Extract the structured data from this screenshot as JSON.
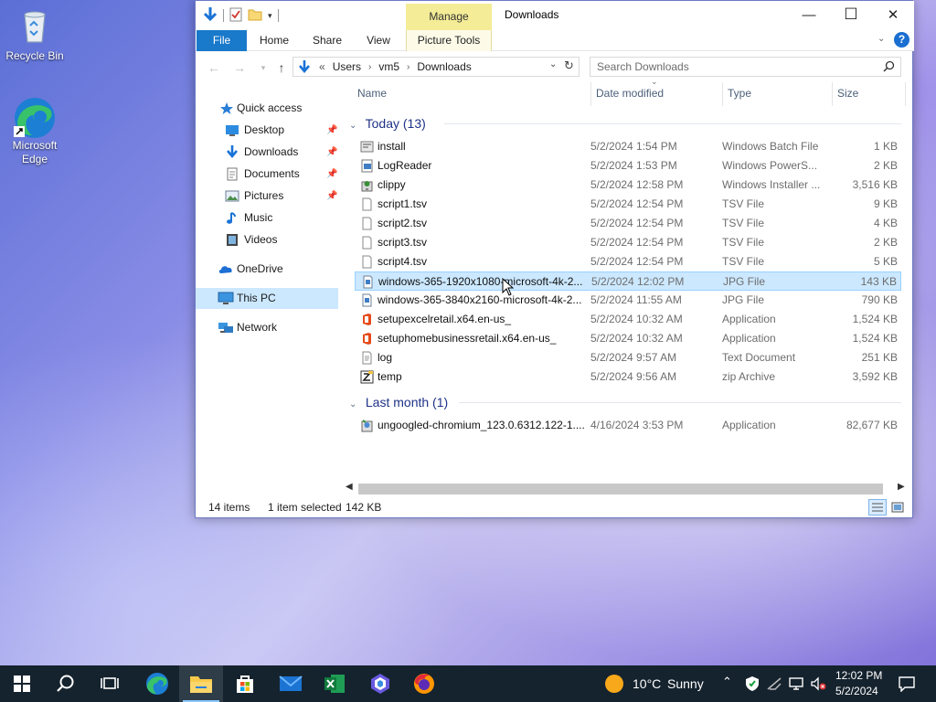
{
  "desktop": {
    "icons": [
      {
        "label": "Recycle Bin"
      },
      {
        "label": "Microsoft Edge"
      }
    ]
  },
  "window": {
    "title": "Downloads",
    "manage_tab": "Manage",
    "ribbon_tabs": [
      "File",
      "Home",
      "Share",
      "View",
      "Picture Tools"
    ],
    "controls": {
      "minimize": "—",
      "maximize": "☐",
      "close": "✕"
    },
    "help": "?"
  },
  "address": {
    "prefix": "«",
    "crumbs": [
      "Users",
      "vm5",
      "Downloads"
    ]
  },
  "search": {
    "placeholder": "Search Downloads"
  },
  "nav_pane": {
    "items": [
      {
        "label": "Quick access",
        "icon": "star-icon",
        "pinned": false
      },
      {
        "label": "Desktop",
        "icon": "desktop-folder-icon",
        "pinned": true
      },
      {
        "label": "Downloads",
        "icon": "download-arrow-icon",
        "pinned": true
      },
      {
        "label": "Documents",
        "icon": "documents-icon",
        "pinned": true
      },
      {
        "label": "Pictures",
        "icon": "pictures-icon",
        "pinned": true
      },
      {
        "label": "Music",
        "icon": "music-note-icon",
        "pinned": false
      },
      {
        "label": "Videos",
        "icon": "videos-icon",
        "pinned": false
      },
      {
        "label": "OneDrive",
        "icon": "cloud-icon",
        "pinned": false
      },
      {
        "label": "This PC",
        "icon": "computer-icon",
        "pinned": false,
        "selected": true
      },
      {
        "label": "Network",
        "icon": "network-icon",
        "pinned": false
      }
    ]
  },
  "columns": {
    "name": "Name",
    "date": "Date modified",
    "type": "Type",
    "size": "Size"
  },
  "groups": [
    {
      "header": "Today (13)",
      "files": [
        {
          "name": "install",
          "date": "5/2/2024 1:54 PM",
          "type": "Windows Batch File",
          "size": "1 KB",
          "icon": "batch-file-icon"
        },
        {
          "name": "LogReader",
          "date": "5/2/2024 1:53 PM",
          "type": "Windows PowerS...",
          "size": "2 KB",
          "icon": "powershell-file-icon"
        },
        {
          "name": "clippy",
          "date": "5/2/2024 12:58 PM",
          "type": "Windows Installer ...",
          "size": "3,516 KB",
          "icon": "installer-icon"
        },
        {
          "name": "script1.tsv",
          "date": "5/2/2024 12:54 PM",
          "type": "TSV File",
          "size": "9 KB",
          "icon": "blank-file-icon"
        },
        {
          "name": "script2.tsv",
          "date": "5/2/2024 12:54 PM",
          "type": "TSV File",
          "size": "4 KB",
          "icon": "blank-file-icon"
        },
        {
          "name": "script3.tsv",
          "date": "5/2/2024 12:54 PM",
          "type": "TSV File",
          "size": "2 KB",
          "icon": "blank-file-icon"
        },
        {
          "name": "script4.tsv",
          "date": "5/2/2024 12:54 PM",
          "type": "TSV File",
          "size": "5 KB",
          "icon": "blank-file-icon"
        },
        {
          "name": "windows-365-1920x1080-microsoft-4k-2...",
          "date": "5/2/2024 12:02 PM",
          "type": "JPG File",
          "size": "143 KB",
          "icon": "image-file-icon",
          "selected": true
        },
        {
          "name": "windows-365-3840x2160-microsoft-4k-2...",
          "date": "5/2/2024 11:55 AM",
          "type": "JPG File",
          "size": "790 KB",
          "icon": "image-file-icon"
        },
        {
          "name": "setupexcelretail.x64.en-us_",
          "date": "5/2/2024 10:32 AM",
          "type": "Application",
          "size": "1,524 KB",
          "icon": "office-setup-icon"
        },
        {
          "name": "setuphomebusinessretail.x64.en-us_",
          "date": "5/2/2024 10:32 AM",
          "type": "Application",
          "size": "1,524 KB",
          "icon": "office-setup-icon"
        },
        {
          "name": "log",
          "date": "5/2/2024 9:57 AM",
          "type": "Text Document",
          "size": "251 KB",
          "icon": "text-file-icon"
        },
        {
          "name": "temp",
          "date": "5/2/2024 9:56 AM",
          "type": "zip Archive",
          "size": "3,592 KB",
          "icon": "zip-archive-icon"
        }
      ]
    },
    {
      "header": "Last month (1)",
      "files": [
        {
          "name": "ungoogled-chromium_123.0.6312.122-1....",
          "date": "4/16/2024 3:53 PM",
          "type": "Application",
          "size": "82,677 KB",
          "icon": "installer-app-icon"
        }
      ]
    }
  ],
  "status": {
    "count": "14 items",
    "selection": "1 item selected",
    "size": "142 KB"
  },
  "taskbar": {
    "weather_temp": "10°C",
    "weather_desc": "Sunny",
    "time": "12:02 PM",
    "date": "5/2/2024"
  },
  "colors": {
    "accent": "#1979ca",
    "selection": "#cce8ff",
    "taskbar": "#15232e",
    "manage": "#f4ec96"
  }
}
